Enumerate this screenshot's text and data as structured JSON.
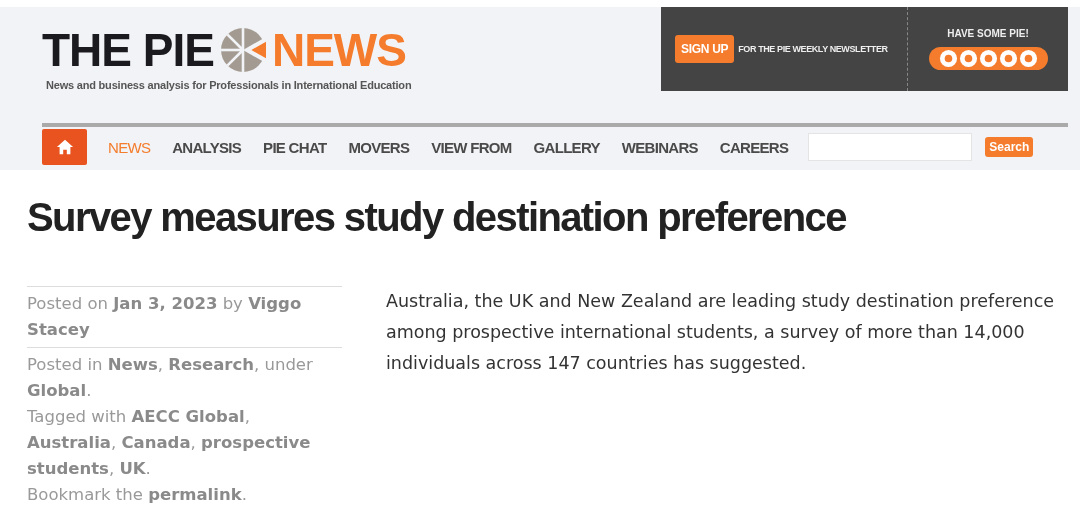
{
  "logo": {
    "word_1": "THE PIE",
    "word_2": "NEWS",
    "tagline": "News and business analysis for Professionals in International Education"
  },
  "promo": {
    "signup_button": "SIGN UP",
    "signup_text": "FOR THE PIE WEEKLY NEWSLETTER",
    "social_title": "HAVE SOME PIE!"
  },
  "nav": {
    "items": [
      {
        "label": "NEWS",
        "selected": true
      },
      {
        "label": "ANALYSIS",
        "selected": false
      },
      {
        "label": "PIE CHAT",
        "selected": false
      },
      {
        "label": "MOVERS",
        "selected": false
      },
      {
        "label": "VIEW FROM",
        "selected": false
      },
      {
        "label": "GALLERY",
        "selected": false
      },
      {
        "label": "WEBINARS",
        "selected": false
      },
      {
        "label": "CAREERS",
        "selected": false
      }
    ],
    "search_button": "Search"
  },
  "article": {
    "title": "Survey measures study destination preference",
    "meta": [
      {
        "text": "Posted on **Jan 3, 2023** by **Viggo Stacey**"
      },
      {
        "text": "Posted in **News**, **Research**, under **Global**.\nTagged with **AECC Global**, **Australia**, **Canada**, **prospective students**, **UK**.\nBookmark the **permalink**."
      }
    ],
    "body": "Australia, the UK and New Zealand are leading study destination preference among prospective international students, a survey of more than 14,000 individuals across 147 countries has suggested."
  }
}
